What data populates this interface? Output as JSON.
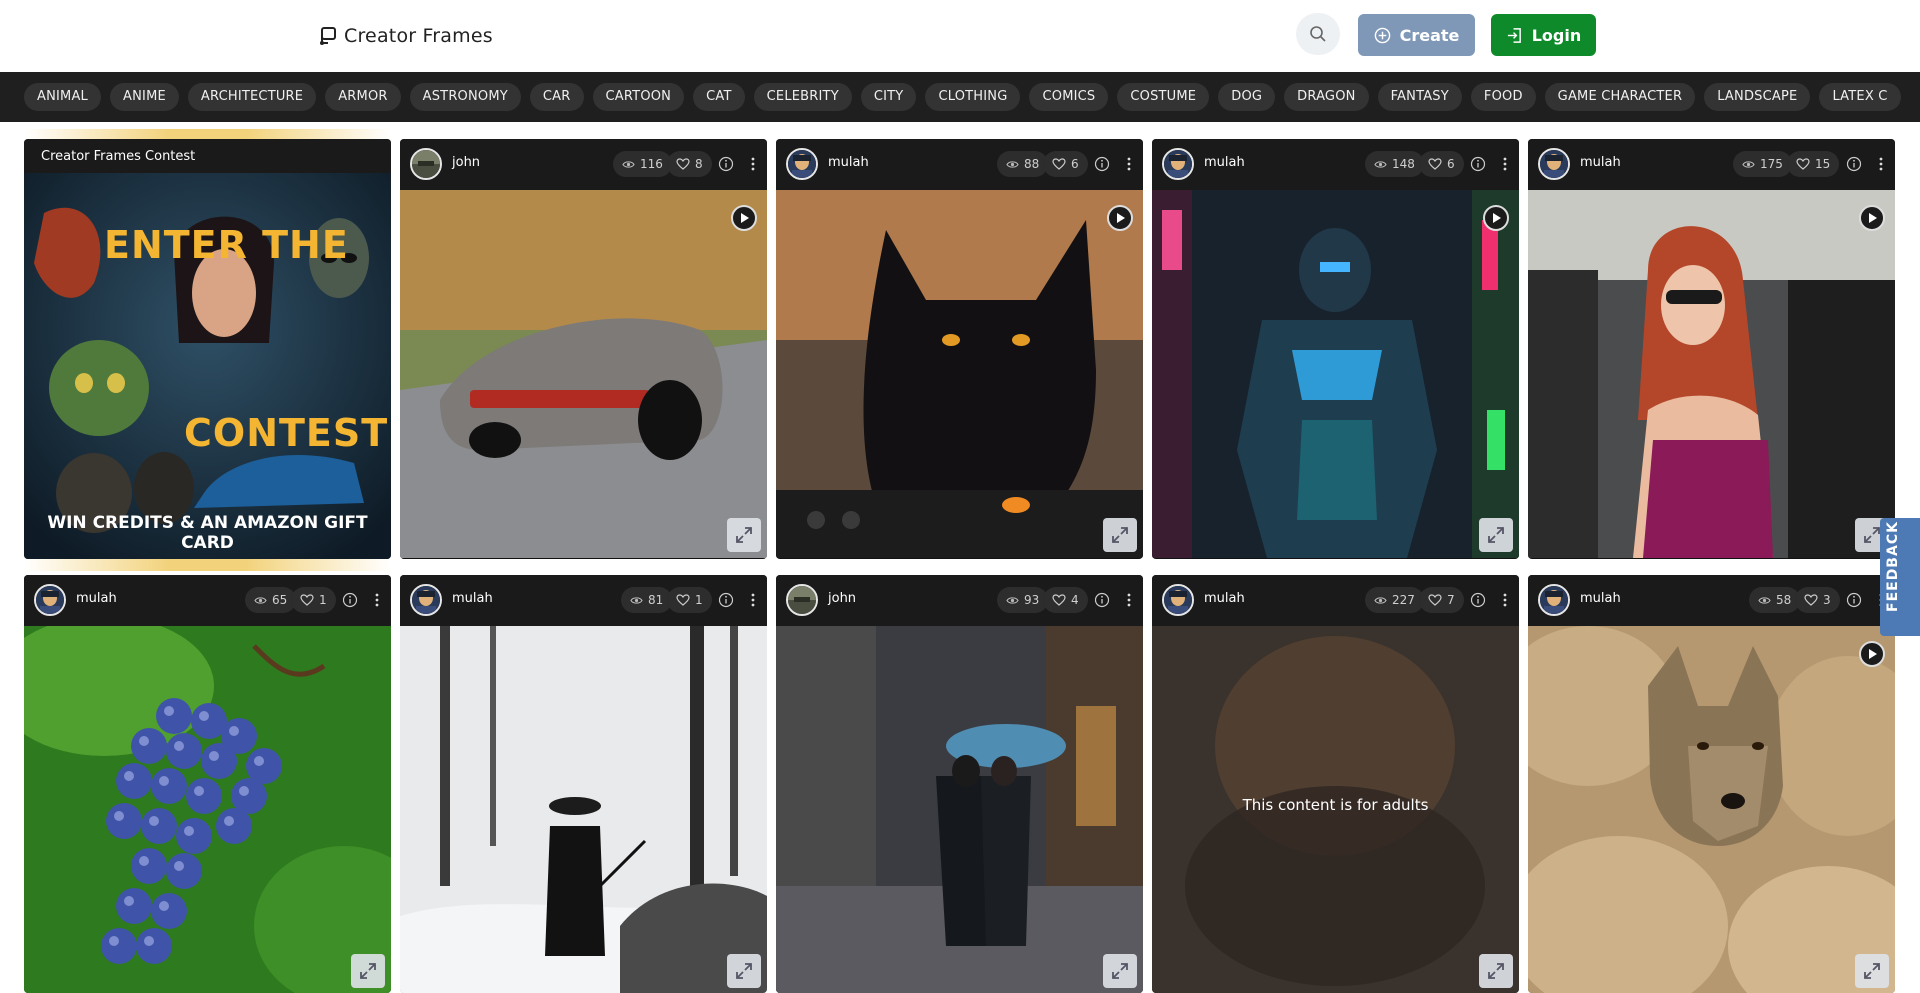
{
  "brand": {
    "name": "Creator Frames"
  },
  "header": {
    "create_label": "Create",
    "login_label": "Login"
  },
  "categories": [
    "ANIMAL",
    "ANIME",
    "ARCHITECTURE",
    "ARMOR",
    "ASTRONOMY",
    "CAR",
    "CARTOON",
    "CAT",
    "CELEBRITY",
    "CITY",
    "CLOTHING",
    "COMICS",
    "COSTUME",
    "DOG",
    "DRAGON",
    "FANTASY",
    "FOOD",
    "GAME CHARACTER",
    "LANDSCAPE",
    "LATEX C"
  ],
  "contest": {
    "title": "Creator Frames Contest",
    "line1": "ENTER THE",
    "line2": "CONTEST",
    "line3": "WIN CREDITS & AN AMAZON GIFT CARD"
  },
  "cards": [
    {
      "user": "john",
      "views": "116",
      "likes": "8",
      "play": true,
      "scene": "car"
    },
    {
      "user": "mulah",
      "views": "88",
      "likes": "6",
      "play": true,
      "scene": "cat"
    },
    {
      "user": "mulah",
      "views": "148",
      "likes": "6",
      "play": true,
      "scene": "armor"
    },
    {
      "user": "mulah",
      "views": "175",
      "likes": "15",
      "play": true,
      "scene": "woman"
    },
    {
      "user": "mulah",
      "views": "65",
      "likes": "1",
      "play": false,
      "scene": "grapes"
    },
    {
      "user": "mulah",
      "views": "81",
      "likes": "1",
      "play": false,
      "scene": "snow"
    },
    {
      "user": "john",
      "views": "93",
      "likes": "4",
      "play": false,
      "scene": "rain"
    },
    {
      "user": "mulah",
      "views": "227",
      "likes": "7",
      "play": false,
      "scene": "adult",
      "adult_text": "This content is for adults"
    },
    {
      "user": "mulah",
      "views": "58",
      "likes": "3",
      "play": true,
      "scene": "wolf"
    }
  ],
  "feedback": "FEEDBACK",
  "colors": {
    "create": "#8098b8",
    "login": "#0f8a2a",
    "catbar": "#1f1f1f",
    "feedback": "#4d7ab5",
    "contest_text": "#f4b532"
  }
}
